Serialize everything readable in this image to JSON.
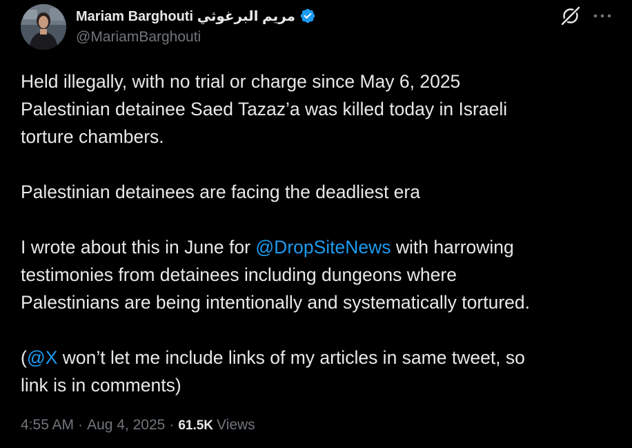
{
  "author": {
    "display_name": "Mariam Barghouti مريم البرغوثي",
    "handle": "@MariamBarghouti",
    "verified_icon": "verified-badge-icon"
  },
  "actions": {
    "grok_icon": "grok-icon",
    "more_icon": "more-icon"
  },
  "tweet": {
    "p1": {
      "l1": "Held illegally, with no trial or charge since May 6, 2025",
      "l2": "Palestinian detainee Saed Tazaz’a was killed today in Israeli",
      "l3": "torture chambers."
    },
    "p2": {
      "l1": "Palestinian detainees are facing the deadliest era"
    },
    "p3": {
      "l1_before": "I wrote about this in June for ",
      "l1_mention": "@DropSiteNews",
      "l1_after": " with harrowing",
      "l2": "testimonies from detainees including dungeons where",
      "l3": "Palestinians are being intentionally and systematically tortured."
    },
    "p4": {
      "l1_open": "(",
      "l1_mention": "@X",
      "l1_after": " won’t let me include links of my articles in same tweet, so",
      "l2": "link is in comments)"
    }
  },
  "meta": {
    "time": "4:55 AM",
    "separator": "·",
    "date": "Aug 4, 2025",
    "views_count": "61.5K",
    "views_label": "Views"
  },
  "colors": {
    "background": "#000000",
    "text": "#e7e9ea",
    "secondary": "#71767b",
    "link": "#1d9bf0"
  }
}
